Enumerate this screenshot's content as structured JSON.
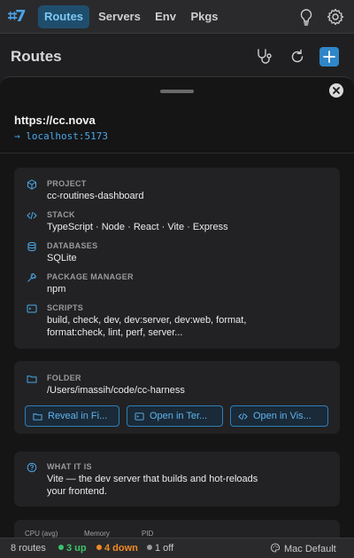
{
  "nav": {
    "logo": "⌗7",
    "tabs": [
      {
        "label": "Routes",
        "active": true
      },
      {
        "label": "Servers"
      },
      {
        "label": "Env"
      },
      {
        "label": "Pkgs"
      }
    ],
    "icons": [
      "lightbulb-icon",
      "gear-icon"
    ]
  },
  "header": {
    "title": "Routes",
    "icons": [
      "stethoscope-icon",
      "refresh-icon",
      "plus-icon"
    ]
  },
  "detail": {
    "url": "https://cc.nova",
    "target_arrow": "→",
    "target": "localhost:5173",
    "project": {
      "label": "PROJECT",
      "value": "cc-routines-dashboard"
    },
    "stack": {
      "label": "STACK",
      "value": "TypeScript · Node · React · Vite · Express"
    },
    "databases": {
      "label": "DATABASES",
      "value": "SQLite"
    },
    "package_manager": {
      "label": "PACKAGE MANAGER",
      "value": "npm"
    },
    "scripts": {
      "label": "SCRIPTS",
      "value_line1": "build, check, dev, dev:server, dev:web, format,",
      "value_line2": "format:check, lint, perf, server..."
    },
    "folder": {
      "label": "FOLDER",
      "value": "/Users/imassih/code/cc-harness"
    },
    "actions": {
      "reveal": "Reveal in Fi...",
      "terminal": "Open in Ter...",
      "vscode": "Open in Vis..."
    },
    "what_it_is": {
      "label": "WHAT IT IS",
      "value_line1": "Vite — the dev server that builds and hot-reloads",
      "value_line2": "your frontend."
    },
    "metrics": {
      "cpu_label": "CPU (avg)",
      "memory_label": "Memory",
      "pid_label": "PID"
    }
  },
  "status": {
    "routes": "8 routes",
    "up": "3 up",
    "down": "4 down",
    "off": "1 off",
    "theme": "Mac Default",
    "colors": {
      "up": "#3cc46a",
      "down": "#f08a24",
      "off": "#9a9a9e"
    }
  }
}
